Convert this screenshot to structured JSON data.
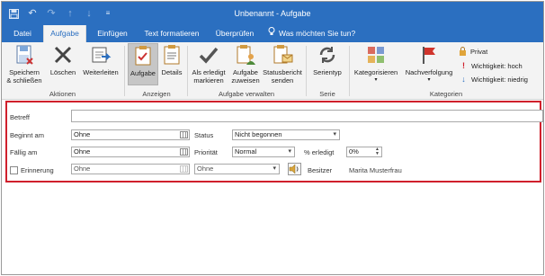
{
  "window": {
    "title": "Unbenannt - Aufgabe"
  },
  "qat": {
    "icons": [
      "save-icon",
      "undo-icon",
      "redo-icon",
      "up-arrow-icon",
      "down-arrow-icon",
      "customize-icon"
    ]
  },
  "tabs": [
    {
      "label": "Datei",
      "active": false
    },
    {
      "label": "Aufgabe",
      "active": true
    },
    {
      "label": "Einfügen",
      "active": false
    },
    {
      "label": "Text formatieren",
      "active": false
    },
    {
      "label": "Überprüfen",
      "active": false
    }
  ],
  "tellme": {
    "label": "Was möchten Sie tun?",
    "icon": "lightbulb-icon"
  },
  "ribbon": {
    "groups": [
      {
        "label": "Aktionen"
      },
      {
        "label": "Anzeigen"
      },
      {
        "label": "Aufgabe verwalten"
      },
      {
        "label": "Serie"
      },
      {
        "label": "Kategorien"
      }
    ],
    "buttons": {
      "save_close": [
        "Speichern",
        "& schließen"
      ],
      "delete": "Löschen",
      "forward": "Weiterleiten",
      "task": "Aufgabe",
      "details": "Details",
      "mark_complete": [
        "Als erledigt",
        "markieren"
      ],
      "assign": [
        "Aufgabe",
        "zuweisen"
      ],
      "status_report": [
        "Statusbericht",
        "senden"
      ],
      "recurrence": "Serientyp",
      "categorize": "Kategorisieren",
      "follow_up": "Nachverfolgung",
      "private": "Privat",
      "high_importance": "Wichtigkeit: hoch",
      "low_importance": "Wichtigkeit: niedrig"
    }
  },
  "form": {
    "subject_label": "Betreff",
    "subject_value": "",
    "start_label": "Beginnt am",
    "start_value": "Ohne",
    "due_label": "Fällig am",
    "due_value": "Ohne",
    "reminder_label": "Erinnerung",
    "reminder_date": "Ohne",
    "reminder_time": "Ohne",
    "status_label": "Status",
    "status_value": "Nicht begonnen",
    "priority_label": "Priorität",
    "priority_value": "Normal",
    "percent_label": "% erledigt",
    "percent_value": "0%",
    "owner_label": "Besitzer",
    "owner_value": "Marita Musterfrau"
  },
  "colors": {
    "titlebar": "#2b6fc0",
    "ribbon_bg": "#f3f3f3",
    "highlight_border": "#d0202c"
  }
}
